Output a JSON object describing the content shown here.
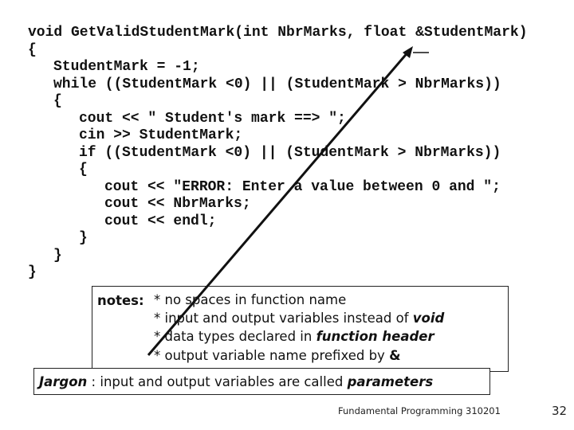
{
  "code_lines": [
    {
      "indent": 0,
      "text": "void GetValidStudentMark(int NbrMarks, float &StudentMark)"
    },
    {
      "indent": 0,
      "text": "{"
    },
    {
      "indent": 1,
      "text": "StudentMark = -1;"
    },
    {
      "indent": 1,
      "text": "while ((StudentMark <0) || (StudentMark > NbrMarks))"
    },
    {
      "indent": 1,
      "text": "{"
    },
    {
      "indent": 2,
      "text": "cout << \" Student's mark ==> \";"
    },
    {
      "indent": 2,
      "text": "cin >> StudentMark;"
    },
    {
      "indent": 2,
      "text": "if ((StudentMark <0) || (StudentMark > NbrMarks))"
    },
    {
      "indent": 2,
      "text": "{"
    },
    {
      "indent": 3,
      "text": "cout << \"ERROR: Enter a value between 0 and \";"
    },
    {
      "indent": 3,
      "text": "cout << NbrMarks;"
    },
    {
      "indent": 3,
      "text": "cout << endl;"
    },
    {
      "indent": 2,
      "text": "}"
    },
    {
      "indent": 1,
      "text": "}"
    },
    {
      "indent": 0,
      "text": "}"
    }
  ],
  "notes": {
    "label": "notes:",
    "items": [
      {
        "text": "* no spaces in function name",
        "emph": ""
      },
      {
        "text": "* input and output variables instead of ",
        "emph": "void"
      },
      {
        "text": "* data types declared in ",
        "emph": "function header"
      },
      {
        "text": "* output variable name prefixed by ",
        "emph": "&"
      }
    ]
  },
  "jargon": {
    "label": "Jargon",
    "text": " : input and output variables are called ",
    "emph": "parameters"
  },
  "footer": {
    "course": "Fundamental Programming 310201",
    "page_number": "32"
  }
}
